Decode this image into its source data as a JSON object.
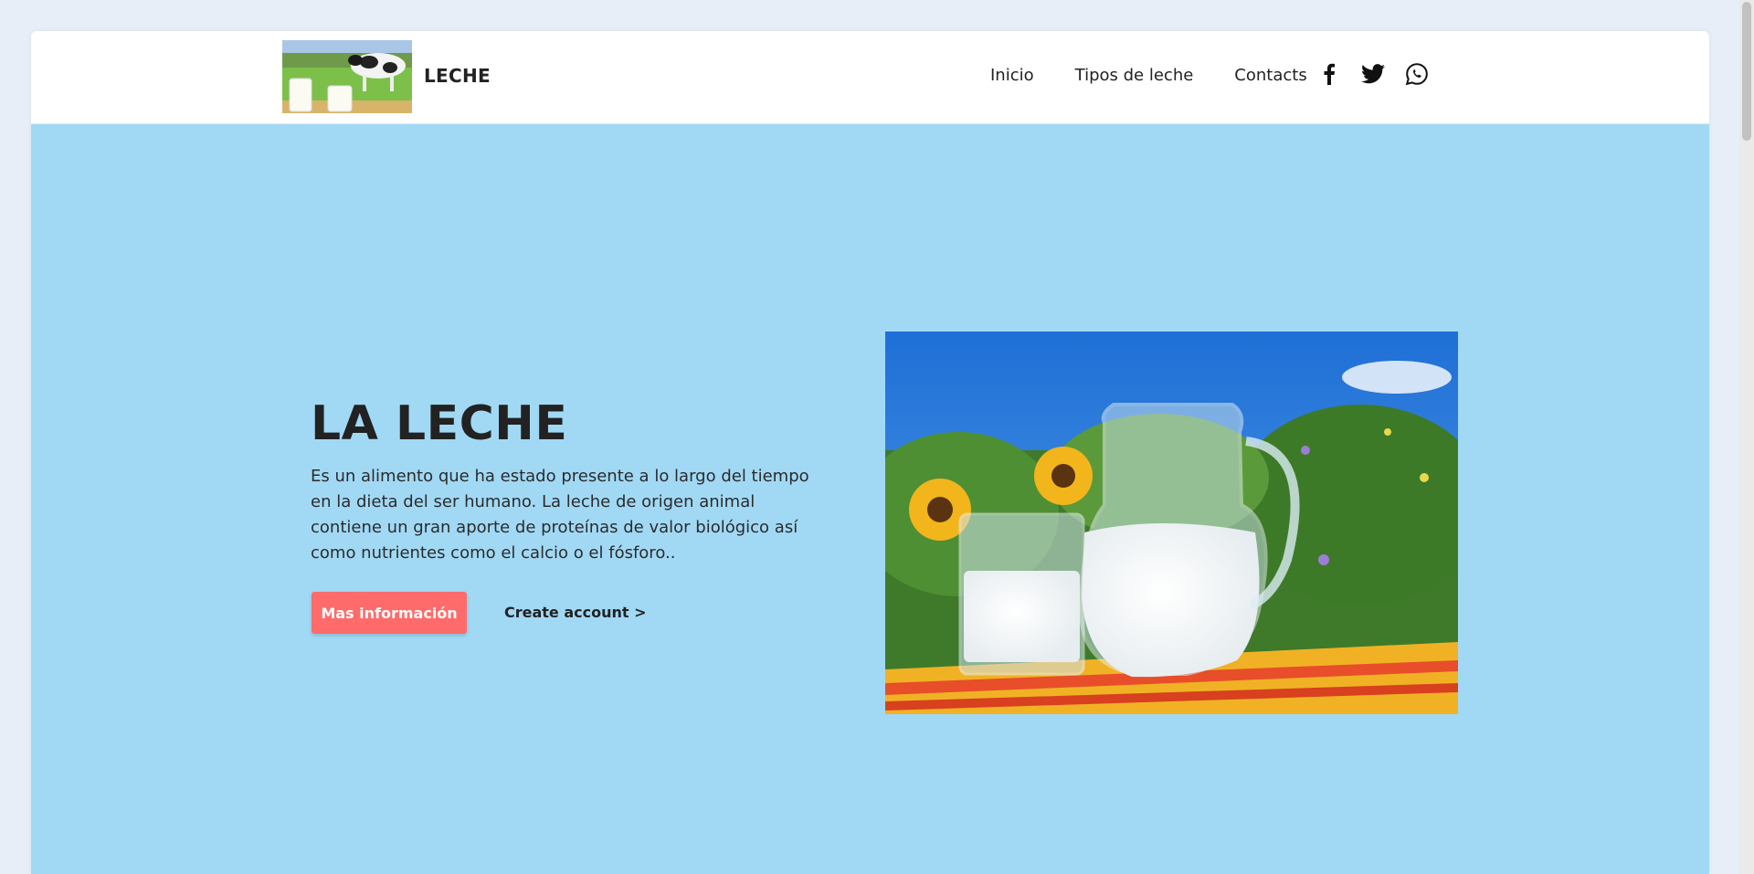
{
  "header": {
    "brand": "LECHE",
    "logo_alt": "cow-and-milk-logo",
    "nav": [
      {
        "label": "Inicio"
      },
      {
        "label": "Tipos de leche"
      },
      {
        "label": "Contacts"
      }
    ],
    "social_icons": [
      "facebook-icon",
      "twitter-icon",
      "whatsapp-icon"
    ]
  },
  "hero": {
    "title": "LA LECHE",
    "text": "Es un alimento que ha estado presente a lo largo del tiempo en la dieta del ser humano. La leche de origen animal contiene un gran aporte de proteínas de valor biológico así como nutrientes como el calcio o el fósforo..",
    "primary_button": "Mas información",
    "secondary_link": "Create account >",
    "image": "milk-jug-and-glass-with-sunflowers"
  },
  "colors": {
    "hero_background": "#a1d9f5",
    "button_primary": "#ff6b6b",
    "navbar_background": "#ffffff"
  }
}
